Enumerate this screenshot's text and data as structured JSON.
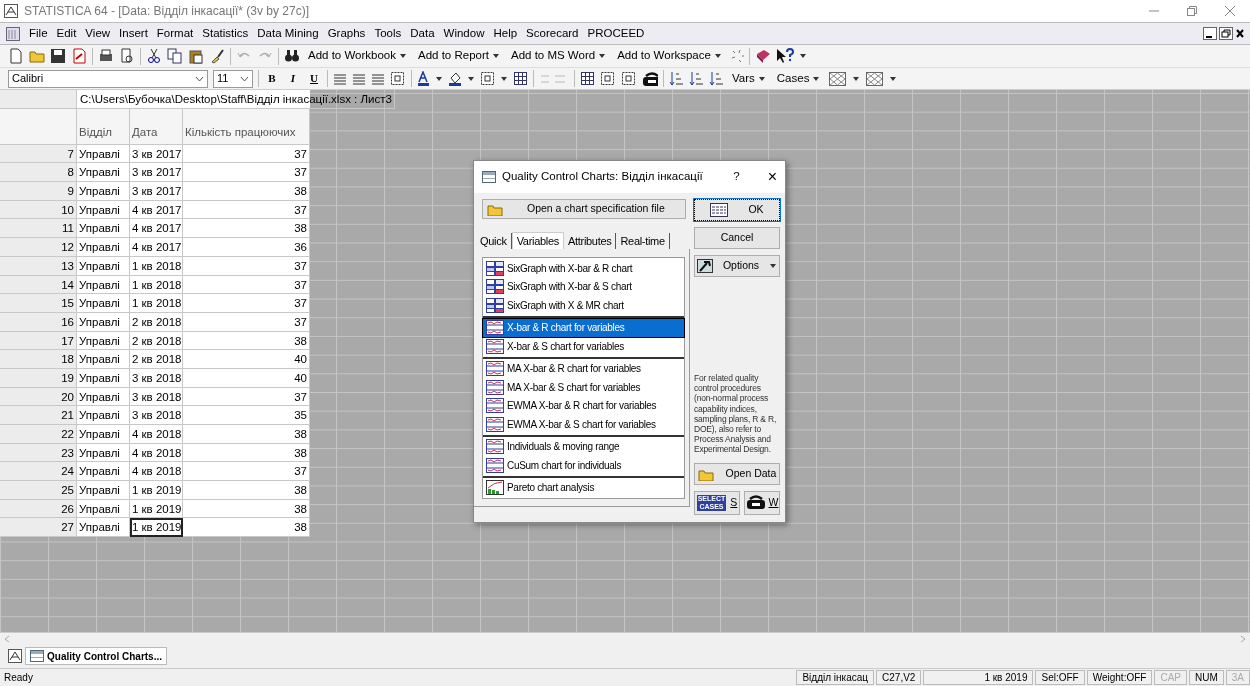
{
  "window": {
    "title": "STATISTICA 64 - [Data: Відділ інкасації* (3v by 27c)]"
  },
  "menu": [
    "File",
    "Edit",
    "View",
    "Insert",
    "Format",
    "Statistics",
    "Data Mining",
    "Graphs",
    "Tools",
    "Data",
    "Window",
    "Help",
    "Scorecard",
    "PROCEED"
  ],
  "toolbar": {
    "dropdowns": [
      "Add to Workbook",
      "Add to Report",
      "Add to MS Word",
      "Add to Workspace"
    ]
  },
  "format_bar": {
    "font": "Calibri",
    "size": "11",
    "styles": [
      "B",
      "I",
      "U"
    ],
    "dropdowns": [
      "Vars",
      "Cases"
    ]
  },
  "sheet": {
    "path": "C:\\Users\\Бубочка\\Desktop\\Staff\\Відділ інкасації.xlsx : Лист3",
    "columns": [
      "Відділ",
      "Дата",
      "Кількість працюючих"
    ],
    "rows": [
      {
        "n": "7",
        "cells": [
          "Управлі",
          "3 кв 2017",
          "37"
        ],
        "selected": false
      },
      {
        "n": "8",
        "cells": [
          "Управлі",
          "3 кв 2017",
          "37"
        ],
        "selected": false
      },
      {
        "n": "9",
        "cells": [
          "Управлі",
          "3 кв 2017",
          "38"
        ],
        "selected": false
      },
      {
        "n": "10",
        "cells": [
          "Управлі",
          "4 кв 2017",
          "37"
        ],
        "selected": false
      },
      {
        "n": "11",
        "cells": [
          "Управлі",
          "4 кв 2017",
          "38"
        ],
        "selected": false
      },
      {
        "n": "12",
        "cells": [
          "Управлі",
          "4 кв 2017",
          "36"
        ],
        "selected": false
      },
      {
        "n": "13",
        "cells": [
          "Управлі",
          "1 кв 2018",
          "37"
        ],
        "selected": false
      },
      {
        "n": "14",
        "cells": [
          "Управлі",
          "1 кв 2018",
          "37"
        ],
        "selected": false
      },
      {
        "n": "15",
        "cells": [
          "Управлі",
          "1 кв 2018",
          "37"
        ],
        "selected": false
      },
      {
        "n": "16",
        "cells": [
          "Управлі",
          "2 кв 2018",
          "37"
        ],
        "selected": false
      },
      {
        "n": "17",
        "cells": [
          "Управлі",
          "2 кв 2018",
          "38"
        ],
        "selected": false
      },
      {
        "n": "18",
        "cells": [
          "Управлі",
          "2 кв 2018",
          "40"
        ],
        "selected": false
      },
      {
        "n": "19",
        "cells": [
          "Управлі",
          "3 кв 2018",
          "40"
        ],
        "selected": false
      },
      {
        "n": "20",
        "cells": [
          "Управлі",
          "3 кв 2018",
          "37"
        ],
        "selected": false
      },
      {
        "n": "21",
        "cells": [
          "Управлі",
          "3 кв 2018",
          "35"
        ],
        "selected": false
      },
      {
        "n": "22",
        "cells": [
          "Управлі",
          "4 кв 2018",
          "38"
        ],
        "selected": false
      },
      {
        "n": "23",
        "cells": [
          "Управлі",
          "4 кв 2018",
          "38"
        ],
        "selected": false
      },
      {
        "n": "24",
        "cells": [
          "Управлі",
          "4 кв 2018",
          "37"
        ],
        "selected": false
      },
      {
        "n": "25",
        "cells": [
          "Управлі",
          "1 кв 2019",
          "38"
        ],
        "selected": false
      },
      {
        "n": "26",
        "cells": [
          "Управлі",
          "1 кв 2019",
          "38"
        ],
        "selected": false
      },
      {
        "n": "27",
        "cells": [
          "Управлі",
          "1 кв 2019",
          "38"
        ],
        "selected": true
      }
    ]
  },
  "dialog": {
    "title": "Quality Control Charts: Відділ інкасації",
    "help": "?",
    "close": "×",
    "open_spec": "Open a chart specification file",
    "tabs": [
      {
        "label": "Quick",
        "selected": false
      },
      {
        "label": "Variables",
        "selected": true
      },
      {
        "label": "Attributes",
        "selected": false
      },
      {
        "label": "Real-time",
        "selected": false
      }
    ],
    "groups": [
      [
        {
          "kind": "sixgraph",
          "label": "SixGraph with X-bar & R chart",
          "selected": false
        },
        {
          "kind": "sixgraph",
          "label": "SixGraph with X-bar & S chart",
          "selected": false
        },
        {
          "kind": "sixgraph",
          "label": "SixGraph with X & MR chart",
          "selected": false
        }
      ],
      [
        {
          "kind": "chart",
          "label": "X-bar & R chart for variables",
          "selected": true
        },
        {
          "kind": "chart",
          "label": "X-bar & S chart for variables",
          "selected": false
        }
      ],
      [
        {
          "kind": "chart",
          "label": "MA  X-bar & R chart for variables",
          "selected": false
        },
        {
          "kind": "chart",
          "label": "MA  X-bar & S chart for variables",
          "selected": false
        },
        {
          "kind": "chart",
          "label": "EWMA  X-bar & R chart for variables",
          "selected": false
        },
        {
          "kind": "chart",
          "label": "EWMA  X-bar & S chart for variables",
          "selected": false
        }
      ],
      [
        {
          "kind": "chart",
          "label": "Individuals & moving range",
          "selected": false
        },
        {
          "kind": "chart",
          "label": "CuSum chart for individuals",
          "selected": false
        }
      ],
      [
        {
          "kind": "pareto",
          "label": "Pareto chart analysis",
          "selected": false
        }
      ]
    ],
    "ok": "OK",
    "cancel": "Cancel",
    "options": "Options",
    "note": "For related quality control procedures (non-normal process capability indices, sampling plans, R & R, DOE), also refer to Process Analysis and Experimental Design.",
    "open_data": "Open Data",
    "select_cases": [
      "SELECT",
      "CASES"
    ],
    "select_key": "S",
    "weight_key": "W"
  },
  "taskbar": {
    "item": "Quality Control Charts..."
  },
  "status_bar": {
    "left": "Ready",
    "cells": [
      {
        "text": "Відділ інкасац",
        "disabled": false
      },
      {
        "text": "C27,V2",
        "disabled": false
      },
      {
        "text": "1 кв 2019",
        "disabled": false
      },
      {
        "text": "Sel:OFF",
        "disabled": false
      },
      {
        "text": "Weight:OFF",
        "disabled": false
      },
      {
        "text": "CAP",
        "disabled": true
      },
      {
        "text": "NUM",
        "disabled": false
      },
      {
        "text": "3A",
        "disabled": true
      }
    ]
  }
}
